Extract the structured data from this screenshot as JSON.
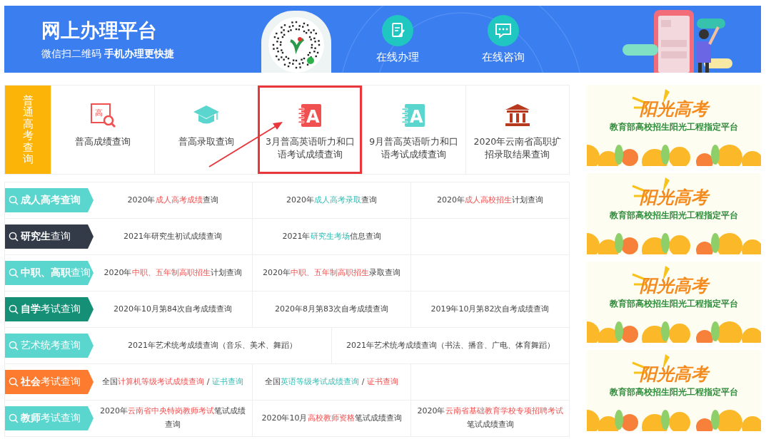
{
  "banner": {
    "title": "网上办理平台",
    "subtitle": "微信扫二维码 **手机办理更快捷**",
    "actions": [
      {
        "label": "在线办理",
        "kind": "edit"
      },
      {
        "label": "在线咨询",
        "kind": "chat"
      }
    ]
  },
  "gaokao": {
    "label": "普通高考查询",
    "tiles": [
      {
        "label": "普高成绩查询",
        "kind": "grade-search",
        "icon_label": "高",
        "highlighted": false
      },
      {
        "label": "普高录取查询",
        "kind": "cap",
        "highlighted": false
      },
      {
        "label": "3月普高英语听力和口语考试成绩查询",
        "kind": "notebook-red",
        "icon_label": "A",
        "highlighted": true
      },
      {
        "label": "9月普高英语听力和口语考试成绩查询",
        "kind": "notebook-teal",
        "icon_label": "A",
        "highlighted": false
      },
      {
        "label": "2020年云南省高职扩招录取结果查询",
        "kind": "building",
        "highlighted": false
      }
    ]
  },
  "categories": [
    {
      "label": "**成人高考查询**",
      "color": "#5bd6cf",
      "wide": false,
      "cells": [
        [
          {
            "text": "2020年",
            "kind": "plain"
          },
          {
            "text": "成人高考成绩",
            "kind": "red"
          },
          {
            "text": "查询",
            "kind": "plain"
          }
        ],
        [
          {
            "text": "2020年",
            "kind": "plain"
          },
          {
            "text": "成人高考录取",
            "kind": "teal"
          },
          {
            "text": "查询",
            "kind": "plain"
          }
        ],
        [
          {
            "text": "2020年",
            "kind": "plain"
          },
          {
            "text": "成人高校招生",
            "kind": "red"
          },
          {
            "text": "计划查询",
            "kind": "plain"
          }
        ]
      ]
    },
    {
      "label": "**研究生**查询",
      "color": "#333b48",
      "wide": false,
      "cells": [
        [
          {
            "text": "2021年研究生初试成绩查询",
            "kind": "plain"
          }
        ],
        [
          {
            "text": "2021年",
            "kind": "plain"
          },
          {
            "text": "研究生考场",
            "kind": "teal"
          },
          {
            "text": "信息查询",
            "kind": "plain"
          }
        ]
      ]
    },
    {
      "label": "**中职、高职**查询",
      "color": "#5bd6cf",
      "wide": false,
      "cells": [
        [
          {
            "text": "2020年",
            "kind": "plain"
          },
          {
            "text": "中职、五年制高职招生",
            "kind": "red"
          },
          {
            "text": "计划查询",
            "kind": "plain"
          }
        ],
        [
          {
            "text": "2020年",
            "kind": "plain"
          },
          {
            "text": "中职、五年制高职招生",
            "kind": "red"
          },
          {
            "text": "录取查询",
            "kind": "plain"
          }
        ]
      ]
    },
    {
      "label": "**自学**考试查询",
      "color": "#158f76",
      "wide": false,
      "cells": [
        [
          {
            "text": "2020年10月第84次自考成绩查询",
            "kind": "plain"
          }
        ],
        [
          {
            "text": "2020年8月第83次自考成绩查询",
            "kind": "plain"
          }
        ],
        [
          {
            "text": "2019年10月第82次自考成绩查询",
            "kind": "plain"
          }
        ]
      ]
    },
    {
      "label": "艺术统考查询",
      "color": "#5bd6cf",
      "wide": true,
      "cells": [
        [
          {
            "text": "2021年艺术统考成绩查询（音乐、美术、舞蹈）",
            "kind": "plain"
          }
        ],
        [
          {
            "text": "2021年艺术统考成绩查询（书法、播音、广电、体育舞蹈）",
            "kind": "plain"
          }
        ]
      ]
    },
    {
      "label": "**社会**考试查询",
      "color": "#fd7b2e",
      "wide": false,
      "cells": [
        [
          {
            "text": "全国",
            "kind": "plain"
          },
          {
            "text": "计算机等级考试成绩查询",
            "kind": "red"
          },
          {
            "text": " / ",
            "kind": "plain"
          },
          {
            "text": "证书查询",
            "kind": "teal"
          }
        ],
        [
          {
            "text": "全国",
            "kind": "plain"
          },
          {
            "text": "英语等级考试成绩查询",
            "kind": "teal"
          },
          {
            "text": " / ",
            "kind": "plain"
          },
          {
            "text": "证书查询",
            "kind": "red"
          }
        ]
      ]
    },
    {
      "label": "**教师**考试查询",
      "color": "#5bd6cf",
      "wide": false,
      "cells": [
        [
          {
            "text": "2020年",
            "kind": "plain"
          },
          {
            "text": "云南省中央特岗教师考试",
            "kind": "red"
          },
          {
            "text": "笔试成绩查询",
            "kind": "plain"
          }
        ],
        [
          {
            "text": "2020年10月",
            "kind": "plain"
          },
          {
            "text": "高校教师资格",
            "kind": "red"
          },
          {
            "text": "笔试成绩查询",
            "kind": "plain"
          }
        ],
        [
          {
            "text": "2020年",
            "kind": "plain"
          },
          {
            "text": "云南省基础教育学校专项招聘考试",
            "kind": "red"
          },
          {
            "text": "笔试成绩查询",
            "kind": "plain"
          }
        ]
      ]
    }
  ],
  "ads": [
    {
      "title": "阳光高考",
      "subtitle": "教育部高校招生阳光工程指定平台"
    },
    {
      "title": "阳光高考",
      "subtitle": "教育部高校招生阳光工程指定平台"
    },
    {
      "title": "阳光高考",
      "subtitle": "教育部高校招生阳光工程指定平台"
    },
    {
      "title": "阳光高考",
      "subtitle": "教育部高校招生阳光工程指定平台"
    }
  ]
}
